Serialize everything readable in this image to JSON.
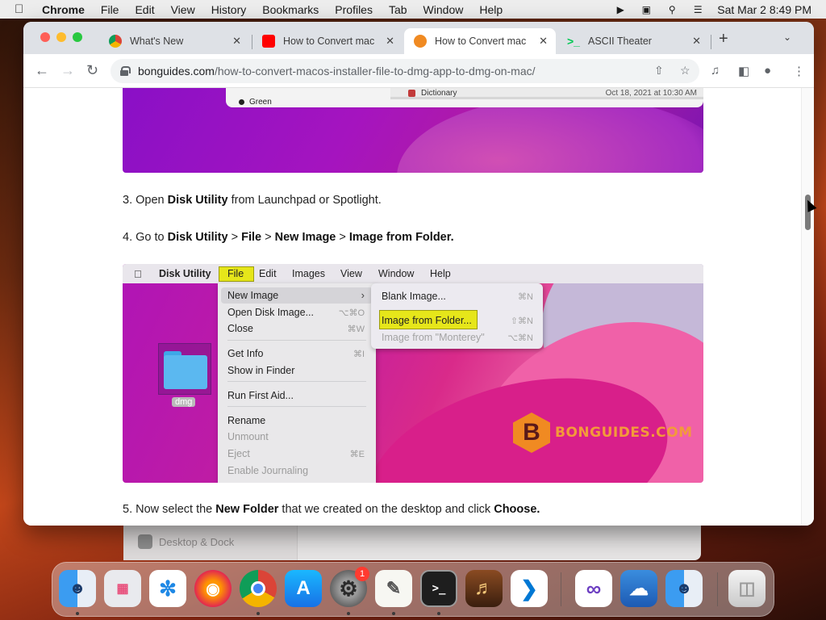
{
  "menubar": {
    "app": "Chrome",
    "items": [
      "File",
      "Edit",
      "View",
      "History",
      "Bookmarks",
      "Profiles",
      "Tab",
      "Window",
      "Help"
    ],
    "clock": "Sat Mar 2  8:49 PM"
  },
  "tabs": [
    {
      "title": "What's New",
      "color": "#8a8a8a"
    },
    {
      "title": "How to Convert mac",
      "color": "#ff0000"
    },
    {
      "title": "How to Convert mac",
      "color": "#f08a22"
    },
    {
      "title": "ASCII Theater",
      "color": "#00c853"
    }
  ],
  "address": {
    "host": "bonguides.com",
    "path": "/how-to-convert-macos-installer-file-to-dmg-app-to-dmg-on-mac/"
  },
  "image1": {
    "green_label": "Green",
    "dict_name": "Dictionary",
    "dict_date": "Oct 18, 2021 at 10:30 AM"
  },
  "steps": {
    "s3": {
      "pre": "3. Open ",
      "b1": "Disk Utility",
      "post": " from Launchpad or Spotlight."
    },
    "s4": {
      "pre": "4. Go to ",
      "b1": "Disk Utility",
      "sep1": " > ",
      "b2": "File",
      "sep2": " > ",
      "b3": "New Image",
      "sep3": " > ",
      "b4": "Image from Folder."
    },
    "s5": {
      "pre": "5. Now select the ",
      "b1": "New Folder",
      "mid": " that we created on the desktop and click ",
      "b2": "Choose."
    }
  },
  "screenshot2": {
    "menubar": [
      "Disk Utility",
      "File",
      "Edit",
      "Images",
      "View",
      "Window",
      "Help"
    ],
    "file_menu": {
      "new_image": "New Image",
      "open_disk_image": "Open Disk Image...",
      "open_sc": "⌥⌘O",
      "close": "Close",
      "close_sc": "⌘W",
      "get_info": "Get Info",
      "get_info_sc": "⌘I",
      "show_in_finder": "Show in Finder",
      "run_first_aid": "Run First Aid...",
      "rename": "Rename",
      "unmount": "Unmount",
      "eject": "Eject",
      "eject_sc": "⌘E",
      "enable_journaling": "Enable Journaling"
    },
    "submenu": {
      "blank_image": "Blank Image...",
      "blank_sc": "⌘N",
      "image_from_folder": "Image from Folder...",
      "folder_sc": "⇧⌘N",
      "image_from_volume": "Image from \"Monterey\"",
      "volume_sc": "⌥⌘N"
    },
    "folder_label": "dmg",
    "brand_letter": "B",
    "brand": "BONGUIDES.COM"
  },
  "background_window": {
    "item": "Desktop & Dock"
  },
  "dock": {
    "apps": [
      "Finder",
      "Launchpad",
      "Safari",
      "Firefox",
      "Chrome",
      "App Store",
      "System Settings",
      "TextEdit",
      "Terminal",
      "Instruments",
      "VS Code",
      "Visual Studio",
      "Weather",
      "Finder Window",
      "Trash"
    ],
    "badge": "1"
  }
}
